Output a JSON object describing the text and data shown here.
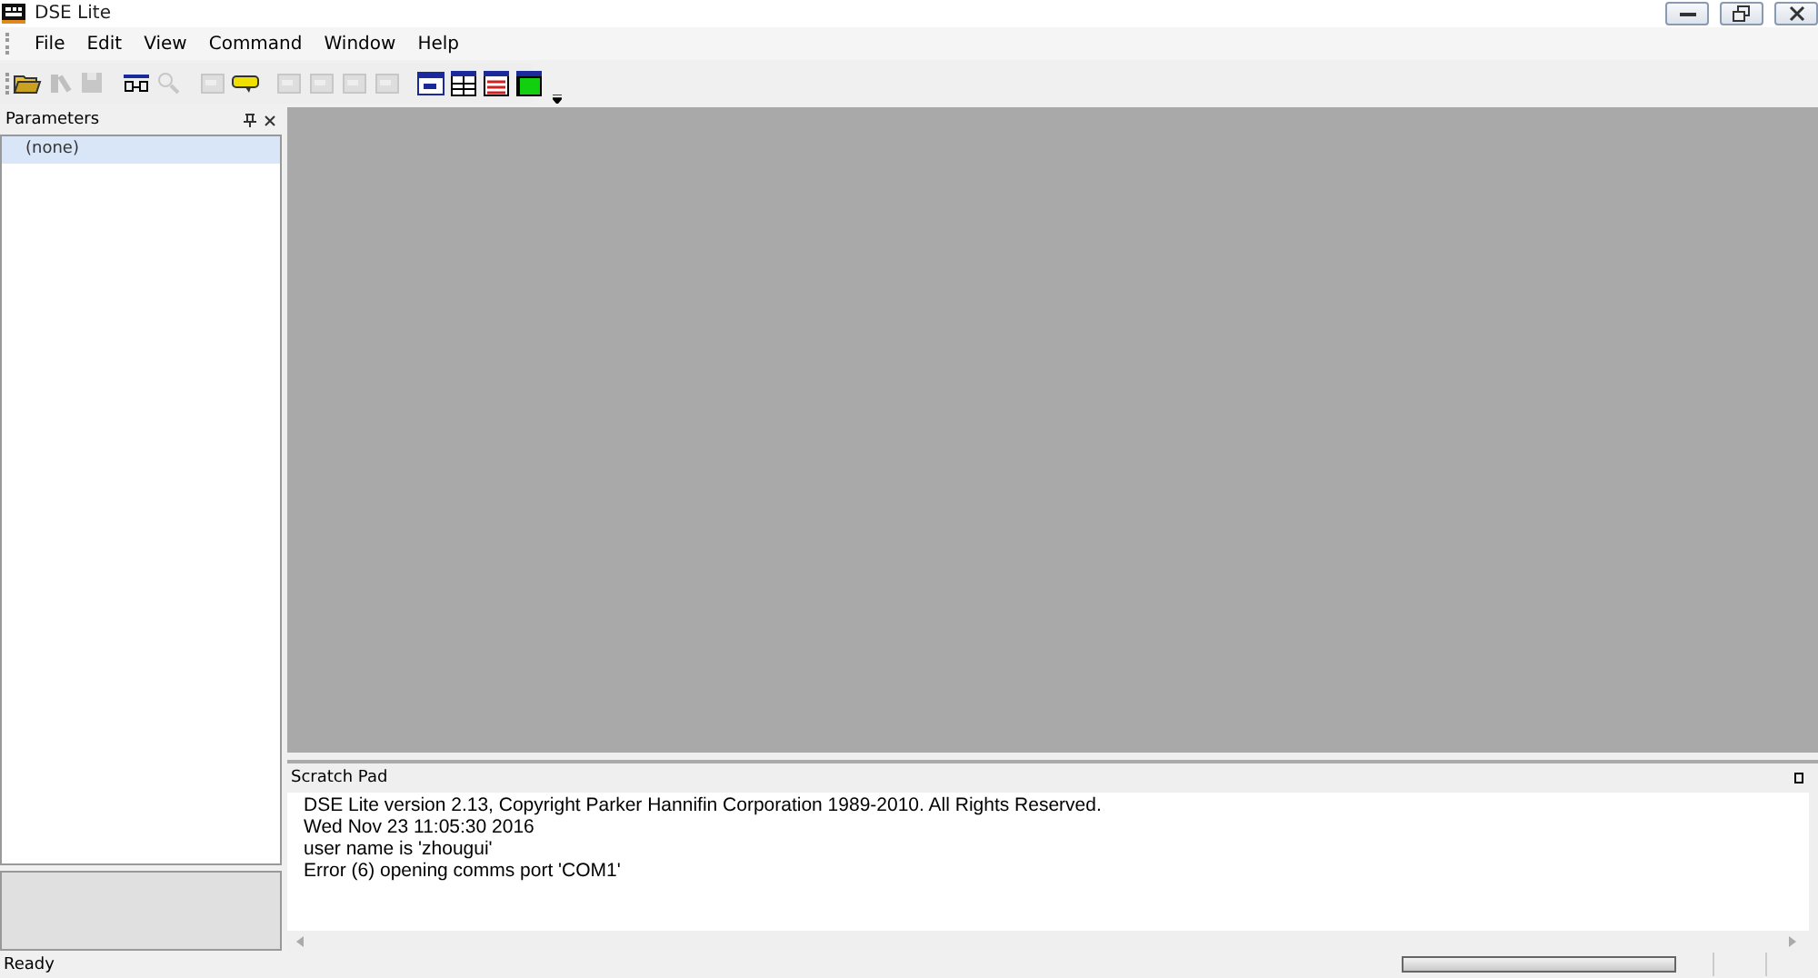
{
  "window": {
    "title": "DSE Lite"
  },
  "menu": [
    "File",
    "Edit",
    "View",
    "Command",
    "Window",
    "Help"
  ],
  "toolbar": [
    {
      "kind": "open",
      "disabled": false
    },
    {
      "kind": "tool",
      "disabled": true
    },
    {
      "kind": "save",
      "disabled": true
    },
    {
      "kind": "sep"
    },
    {
      "kind": "connect",
      "disabled": false
    },
    {
      "kind": "search",
      "disabled": true
    },
    {
      "kind": "sep"
    },
    {
      "kind": "window",
      "disabled": true
    },
    {
      "kind": "comment",
      "disabled": false
    },
    {
      "kind": "sep"
    },
    {
      "kind": "window",
      "disabled": true
    },
    {
      "kind": "window",
      "disabled": true
    },
    {
      "kind": "window",
      "disabled": true
    },
    {
      "kind": "window",
      "disabled": true
    },
    {
      "kind": "sep"
    },
    {
      "kind": "panel",
      "disabled": false
    },
    {
      "kind": "table",
      "disabled": false
    },
    {
      "kind": "chart",
      "disabled": false
    },
    {
      "kind": "green",
      "disabled": false
    }
  ],
  "parameters": {
    "title": "Parameters",
    "items": [
      {
        "label": "(none)",
        "selected": true
      }
    ]
  },
  "scratch_pad": {
    "title": "Scratch Pad",
    "lines": [
      "DSE Lite version 2.13, Copyright Parker Hannifin Corporation 1989-2010.  All Rights Reserved.",
      "Wed Nov 23 11:05:30 2016",
      "user name is 'zhougui'",
      "Error (6) opening comms port 'COM1'"
    ]
  },
  "status_bar": {
    "text": "Ready",
    "progress": {
      "level": 1
    }
  }
}
